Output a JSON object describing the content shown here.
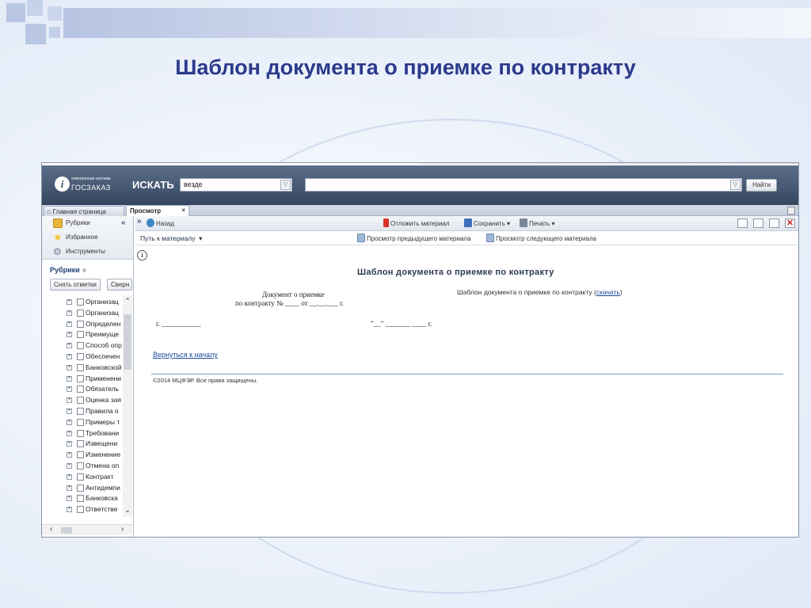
{
  "slide": {
    "title": "Шаблон документа о приемке по контракту"
  },
  "header": {
    "logo_small": "электронная система",
    "logo_big": "ГОСЗАКАЗ",
    "search_label": "ИСКАТЬ",
    "scope_value": "везде",
    "find_label": "Найти"
  },
  "tabs": {
    "home": "Главная страница",
    "view": "Просмотр",
    "close": "×"
  },
  "sidebar": {
    "nav": [
      {
        "label": "Рубрики",
        "icon_color": "#e8b53a"
      },
      {
        "label": "Избранное",
        "icon_color": "#f2c230"
      },
      {
        "label": "Инструменты",
        "icon_color": "#8a97ad"
      }
    ],
    "rubrics_title": "Рубрики",
    "uncheck_label": "Снять отметки",
    "collapse_label": "Сверн",
    "tree": [
      "Организац",
      "Организац",
      "Определен",
      "Преимуще",
      "Способ опр",
      "Обеспечен",
      "Банковской",
      "Применени",
      "Обязатель",
      "Оценка зая",
      "Правила о",
      "Примеры т",
      "Требовани",
      "Извещени",
      "Изменение",
      "Отмена оп",
      "Контракт",
      "Антидемпи",
      "Банковска",
      "Ответстве"
    ]
  },
  "toolbar": {
    "back": "Назад",
    "postpone": "Отложить материал",
    "save": "Сохранить",
    "print": "Печать",
    "path": "Путь к материалу",
    "prev": "Просмотр предыдущего материала",
    "next": "Просмотр следующего материала"
  },
  "document": {
    "title": "Шаблон документа о приемке по контракту",
    "desc_prefix": "Шаблон документа о приемке по контракту (",
    "desc_link": "скачать",
    "desc_suffix": ")",
    "scan_line1": "Документ о приемке",
    "scan_line2": "по контракту № ____ от __.__.___ г.",
    "scan_city": "г. ___________",
    "scan_date": "\"__\" _______ ____ г.",
    "back_link": "Вернуться к началу",
    "copyright": "©2014 МЦФЭР. Все права защищены."
  }
}
